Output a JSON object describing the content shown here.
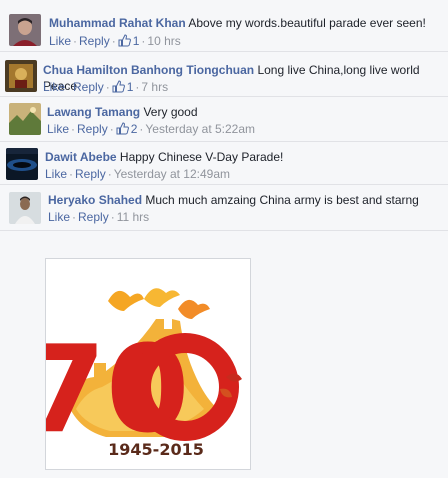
{
  "comments": [
    {
      "name": "Muhammad Rahat Khan",
      "text": "Above my words.beautiful parade ever seen!",
      "like": "Like",
      "reply": "Reply",
      "likes": "1",
      "time": "10 hrs"
    },
    {
      "name": "Chua Hamilton Banhong Tiongchuan",
      "text": "Long live China,long live world Peace",
      "like": "Like",
      "reply": "Reply",
      "likes": "1",
      "time": "7 hrs"
    },
    {
      "name": "Lawang Tamang",
      "text": "Very good",
      "like": "Like",
      "reply": "Reply",
      "likes": "2",
      "time": "Yesterday at 5:22am"
    },
    {
      "name": "Dawit Abebe",
      "text": "Happy Chinese V-Day Parade!",
      "like": "Like",
      "reply": "Reply",
      "time": "Yesterday at 12:49am"
    },
    {
      "name": "Heryako Shahed",
      "text": "Much much amzaing China army is best and starng",
      "like": "Like",
      "reply": "Reply",
      "time": "11 hrs"
    }
  ],
  "separator": "·",
  "photo": {
    "numeral": "70",
    "years": "1945-2015"
  }
}
